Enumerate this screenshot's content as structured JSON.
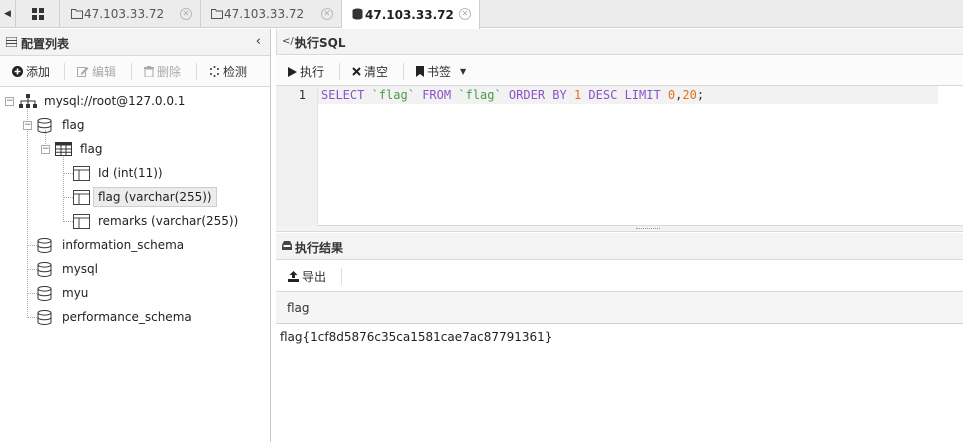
{
  "tabs": [
    {
      "label": "47.103.33.72",
      "icon": "folder-icon",
      "active": false
    },
    {
      "label": "47.103.33.72",
      "icon": "folder-icon",
      "active": false
    },
    {
      "label": "47.103.33.72",
      "icon": "database-icon",
      "active": true
    }
  ],
  "sidebar": {
    "title": "配置列表",
    "toolbar": {
      "add": "添加",
      "edit": "编辑",
      "delete": "删除",
      "check": "检测"
    },
    "tree": {
      "connection": "mysql://root@127.0.0.1",
      "databases": [
        "flag",
        "information_schema",
        "mysql",
        "myu",
        "performance_schema"
      ],
      "table": "flag",
      "columns": [
        "Id (int(11))",
        "flag (varchar(255))",
        "remarks (varchar(255))"
      ]
    }
  },
  "sql_panel": {
    "title": "执行SQL",
    "toolbar": {
      "run": "执行",
      "clear": "清空",
      "bookmark": "书签"
    },
    "editor": {
      "line_number": "1",
      "tokens": [
        "SELECT",
        "`flag`",
        "FROM",
        "`flag`",
        "ORDER BY",
        "1",
        "DESC",
        "LIMIT",
        "0",
        ",",
        "20",
        ";"
      ]
    }
  },
  "result_panel": {
    "title": "执行结果",
    "export": "导出",
    "column": "flag",
    "rows": [
      "flag{1cf8d5876c35ca1581cae7ac87791361}"
    ]
  },
  "colors": {
    "keyword": "#8a54c9",
    "string": "#4a9a4a",
    "number": "#e2711b"
  }
}
